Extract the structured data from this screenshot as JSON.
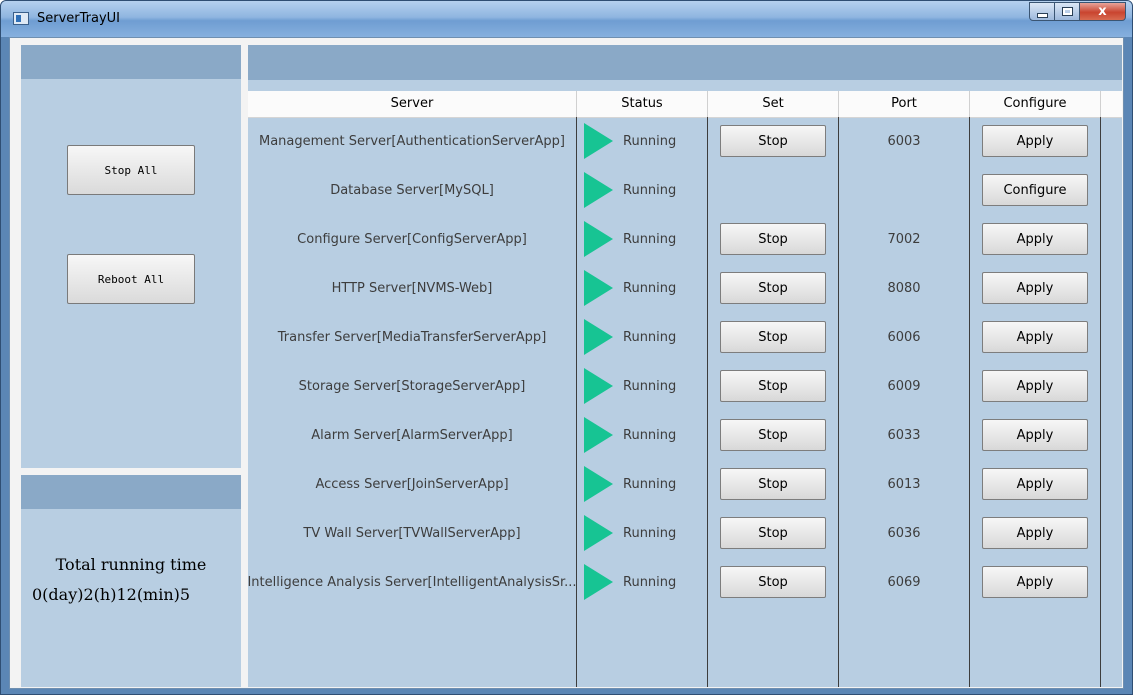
{
  "window": {
    "title": "ServerTrayUI",
    "close_glyph": "x"
  },
  "left": {
    "stop_all_label": "Stop All",
    "reboot_all_label": "Reboot All",
    "runtime_label": "Total running time",
    "runtime_value": "0(day)2(h)12(min)5"
  },
  "table": {
    "headers": {
      "server": "Server",
      "status": "Status",
      "set": "Set",
      "port": "Port",
      "configure": "Configure"
    },
    "rows": [
      {
        "server": "Management Server[AuthenticationServerApp]",
        "status": "Running",
        "set": "Stop",
        "port": "6003",
        "configure": "Apply"
      },
      {
        "server": "Database Server[MySQL]",
        "status": "Running",
        "set": "",
        "port": "",
        "configure": "Configure"
      },
      {
        "server": "Configure Server[ConfigServerApp]",
        "status": "Running",
        "set": "Stop",
        "port": "7002",
        "configure": "Apply"
      },
      {
        "server": "HTTP Server[NVMS-Web]",
        "status": "Running",
        "set": "Stop",
        "port": "8080",
        "configure": "Apply"
      },
      {
        "server": "Transfer Server[MediaTransferServerApp]",
        "status": "Running",
        "set": "Stop",
        "port": "6006",
        "configure": "Apply"
      },
      {
        "server": "Storage Server[StorageServerApp]",
        "status": "Running",
        "set": "Stop",
        "port": "6009",
        "configure": "Apply"
      },
      {
        "server": "Alarm Server[AlarmServerApp]",
        "status": "Running",
        "set": "Stop",
        "port": "6033",
        "configure": "Apply"
      },
      {
        "server": "Access Server[JoinServerApp]",
        "status": "Running",
        "set": "Stop",
        "port": "6013",
        "configure": "Apply"
      },
      {
        "server": "TV Wall Server[TVWallServerApp]",
        "status": "Running",
        "set": "Stop",
        "port": "6036",
        "configure": "Apply"
      },
      {
        "server": "Intelligence Analysis Server[IntelligentAnalysisSr...",
        "status": "Running",
        "set": "Stop",
        "port": "6069",
        "configure": "Apply"
      }
    ]
  },
  "colors": {
    "running_icon": "#17c493",
    "panel_bg": "#b8cee2",
    "panel_header": "#8aa9c7"
  },
  "icons": {
    "status": "play-triangle-icon",
    "app": "window-app-icon"
  }
}
